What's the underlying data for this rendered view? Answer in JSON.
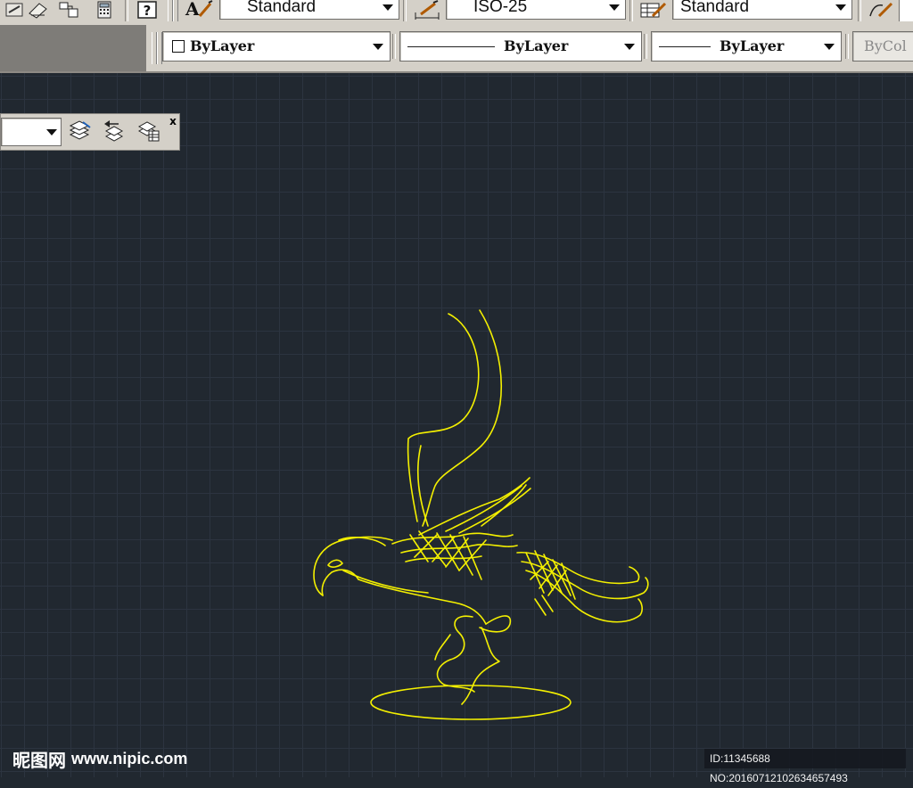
{
  "toolbar_row1": {
    "text_style_value": "Standard",
    "dim_style_value": "ISO-25",
    "table_style_value": "Standard"
  },
  "toolbar_row2": {
    "color_value": "ByLayer",
    "linetype_value": "ByLayer",
    "lineweight_value": "ByLayer",
    "plotstyle_value": "ByCol"
  },
  "layer_toolbar": {
    "close_label": "x"
  },
  "watermark": {
    "site_cn": "昵图网",
    "site_url": "www.nipic.com",
    "image_id": "ID:11345688 NO:20160712102634657493"
  },
  "colors": {
    "canvas_bg": "#212830",
    "grid_minor": "#2c3440",
    "grid_major": "#333d4a",
    "drawing_stroke": "#f4f000",
    "toolbar_bg": "#d4d0c8"
  },
  "icons": [
    "text-style-icon",
    "dim-style-icon",
    "table-style-icon",
    "help-icon",
    "layer-manager-icon",
    "layer-previous-icon",
    "layer-states-icon"
  ]
}
